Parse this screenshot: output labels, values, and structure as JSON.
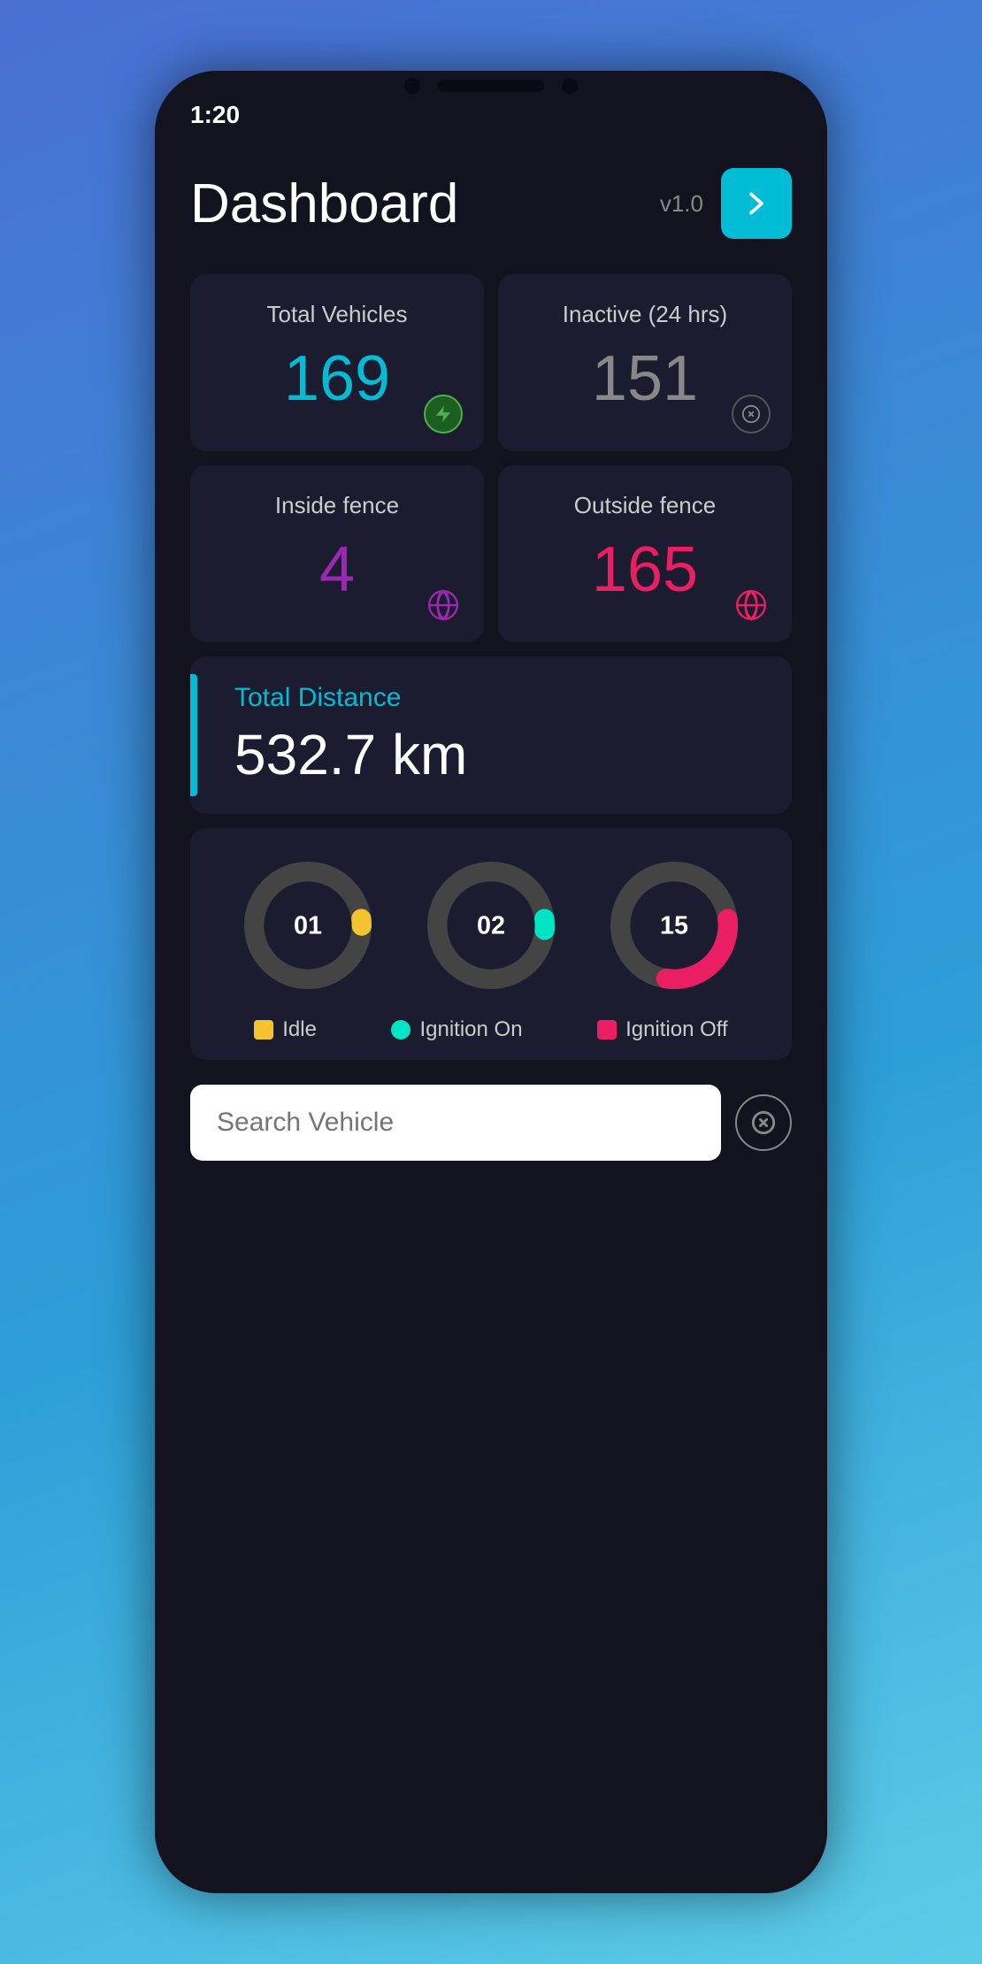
{
  "status_bar": {
    "time": "1:20"
  },
  "header": {
    "title": "Dashboard",
    "version": "v1.0",
    "nav_btn_label": "→"
  },
  "stats": [
    {
      "label": "Total Vehicles",
      "value": "169",
      "color": "cyan",
      "icon": "bolt-icon",
      "icon_style": "green"
    },
    {
      "label": "Inactive (24 hrs)",
      "value": "151",
      "color": "gray",
      "icon": "x-circle-icon",
      "icon_style": "dark"
    },
    {
      "label": "Inside fence",
      "value": "4",
      "color": "purple",
      "icon": "globe-icon-purple",
      "icon_style": "purple-ic"
    },
    {
      "label": "Outside fence",
      "value": "165",
      "color": "red",
      "icon": "globe-icon-red",
      "icon_style": "red-ic"
    }
  ],
  "distance": {
    "label": "Total Distance",
    "value": "532.7 km"
  },
  "charts": [
    {
      "id": "01",
      "value": 1,
      "type": "idle",
      "color": "#f4c430",
      "bg": "#555",
      "dash_offset": 0
    },
    {
      "id": "02",
      "value": 2,
      "type": "ignition_on",
      "color": "#00e5c3",
      "bg": "#555"
    },
    {
      "id": "15",
      "value": 15,
      "type": "ignition_off",
      "color": "#e91e63",
      "bg": "#555"
    }
  ],
  "legends": [
    {
      "label": "Idle",
      "color": "#f4c430"
    },
    {
      "label": "Ignition On",
      "color": "#00e5c3"
    },
    {
      "label": "Ignition Off",
      "color": "#e91e63"
    }
  ],
  "search": {
    "placeholder": "Search Vehicle"
  }
}
